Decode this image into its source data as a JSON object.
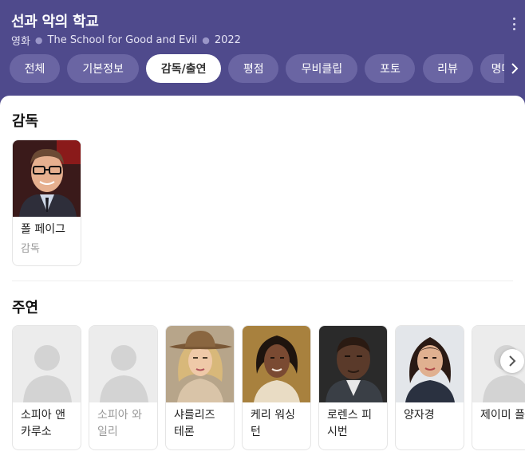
{
  "header": {
    "title": "선과 악의 학교",
    "meta": [
      "영화",
      "The School for Good and Evil",
      "2022"
    ]
  },
  "tabs": [
    {
      "label": "전체",
      "active": false
    },
    {
      "label": "기본정보",
      "active": false
    },
    {
      "label": "감독/출연",
      "active": true
    },
    {
      "label": "평점",
      "active": false
    },
    {
      "label": "무비클립",
      "active": false
    },
    {
      "label": "포토",
      "active": false
    },
    {
      "label": "리뷰",
      "active": false
    },
    {
      "label": "명대사",
      "active": false
    }
  ],
  "director": {
    "heading": "감독",
    "people": [
      {
        "name": "폴 페이그",
        "role": "감독"
      }
    ]
  },
  "cast": {
    "heading": "주연",
    "people": [
      {
        "name": "소피아 앤 카루소",
        "photo": "placeholder"
      },
      {
        "name": "소피아 와 일리",
        "photo": "placeholder"
      },
      {
        "name": "샤를리즈 테론",
        "photo": "portrait"
      },
      {
        "name": "케리 워싱 턴",
        "photo": "portrait"
      },
      {
        "name": "로렌스 피 시번",
        "photo": "portrait"
      },
      {
        "name": "양자경",
        "photo": "portrait"
      },
      {
        "name": "제이미 플 랫터스",
        "photo": "placeholder"
      }
    ]
  },
  "icons": {
    "more": "more-vertical-icon",
    "tabs_next": "chevron-right-icon",
    "cast_next": "chevron-right-icon"
  },
  "colors": {
    "header_bg": "#4f4a8c",
    "tab_bg": "#6a65a3",
    "tab_active_bg": "#ffffff"
  }
}
